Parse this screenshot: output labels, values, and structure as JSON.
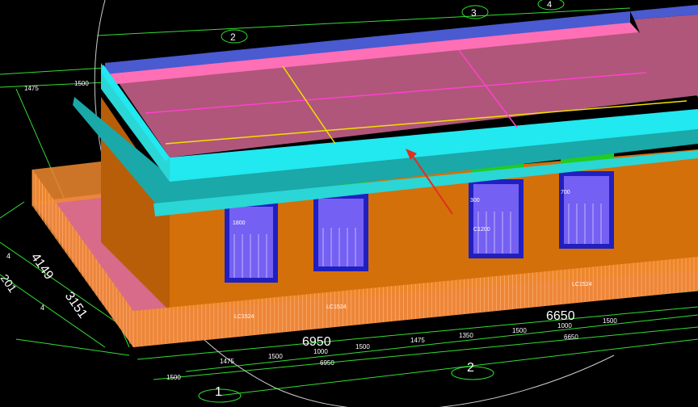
{
  "axis_bubbles": [
    "1",
    "2",
    "2",
    "3",
    "4"
  ],
  "dimensions": {
    "top_left_a": "1475",
    "top_left_b": "1500",
    "left_big_a": "4149",
    "left_big_b": "3151",
    "left_small": "201",
    "left_tick_a": "4",
    "left_tick_b": "4",
    "bottom_total_a": "6950",
    "bottom_total_b": "6650",
    "bottom_row1": [
      "1500",
      "1475",
      "1500",
      "1000",
      "1500",
      "1475",
      "1350",
      "1500",
      "1000",
      "1500"
    ],
    "bottom_row2": [
      "6950",
      "6650"
    ],
    "bottom_row3": [
      "1500"
    ]
  },
  "model_labels": {
    "window_a": "1800",
    "window_b": "300",
    "window_c": "700",
    "window_d": "C1200",
    "rail_a": "LC1524",
    "rail_b": "LC1524",
    "rail_c": "LC1524"
  },
  "colors": {
    "background": "#000000",
    "wall": "#d4700a",
    "roof": "#b0567a",
    "cornice": "#22e8f0",
    "eave_band": "#ff6fb6",
    "vent": "#22cc22",
    "window": "#2020c0",
    "railing": "#f08a30",
    "grid": "#33dd33",
    "arrow": "#e03020"
  }
}
